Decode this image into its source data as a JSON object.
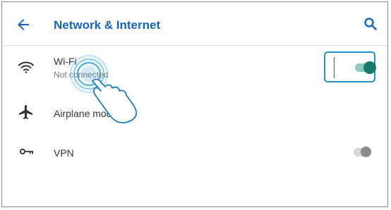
{
  "header": {
    "title": "Network & Internet",
    "back_icon": "arrow-back-icon",
    "search_icon": "search-icon"
  },
  "settings": [
    {
      "id": "wifi",
      "label": "Wi-Fi",
      "sublabel": "Not connected",
      "icon": "wifi-icon",
      "toggle": "on"
    },
    {
      "id": "airplane",
      "label": "Airplane mode",
      "icon": "airplane-icon"
    },
    {
      "id": "vpn",
      "label": "VPN",
      "icon": "vpn-key-icon",
      "toggle": "off"
    }
  ],
  "colors": {
    "title": "#1565c0",
    "accent": "#2196c8",
    "switch_on_thumb": "#1a7c6d",
    "switch_on_track": "#8fc9c0",
    "switch_off_thumb": "#8a8a8a",
    "switch_off_track": "#d6d6d6"
  }
}
